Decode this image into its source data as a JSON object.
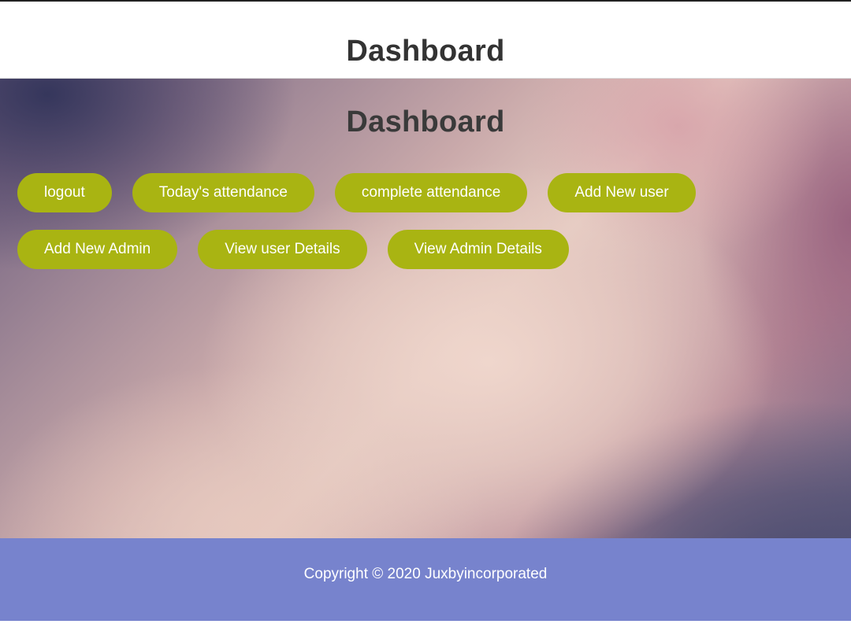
{
  "header": {
    "title": "Dashboard"
  },
  "hero": {
    "title": "Dashboard",
    "buttons_row1": [
      {
        "label": "logout"
      },
      {
        "label": "Today's attendance"
      },
      {
        "label": "complete attendance"
      },
      {
        "label": "Add New user"
      }
    ],
    "buttons_row2": [
      {
        "label": "Add New Admin"
      },
      {
        "label": "View user Details"
      },
      {
        "label": "View Admin Details"
      }
    ]
  },
  "footer": {
    "copyright": "Copyright © 2020 Juxbyincorporated"
  },
  "colors": {
    "button_bg": "#a9b412",
    "footer_bg": "#7783cd",
    "title_text": "#333333"
  }
}
